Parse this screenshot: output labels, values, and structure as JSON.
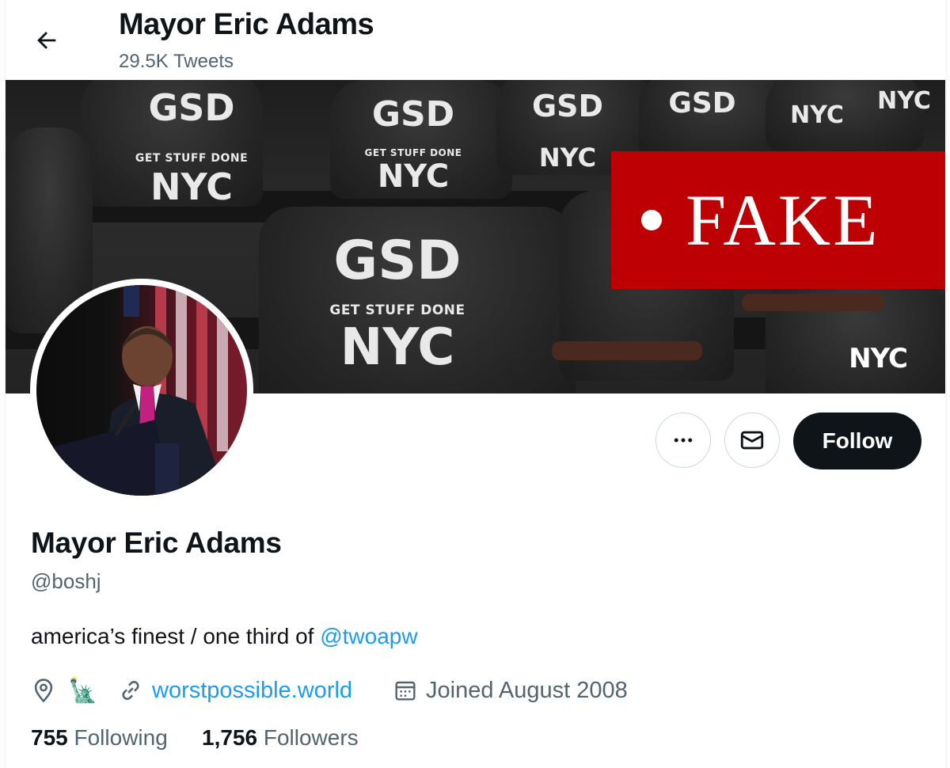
{
  "header": {
    "title": "Mayor Eric Adams",
    "tweet_count": "29.5K Tweets",
    "back_icon": "arrow-left-icon"
  },
  "banner": {
    "shirt_big": "GSD",
    "shirt_small": "GET STUFF DONE",
    "shirt_city": "NYC",
    "logo_text": "NYC",
    "overlay_label": "FAKE",
    "overlay_color": "#bd0003"
  },
  "actions": {
    "more_icon": "more-horizontal-icon",
    "message_icon": "envelope-icon",
    "follow_label": "Follow"
  },
  "profile": {
    "name": "Mayor Eric Adams",
    "handle": "@boshj",
    "bio_text": "america’s finest / one third of ",
    "bio_mention": "@twoapw",
    "location_icon": "map-pin-icon",
    "location_emoji": "🗽",
    "website_icon": "link-icon",
    "website": "worstpossible.world",
    "joined_icon": "calendar-icon",
    "joined": "Joined August 2008",
    "following_count": "755",
    "following_label": "Following",
    "followers_count": "1,756",
    "followers_label": "Followers"
  },
  "colors": {
    "accent": "#1d9bf0",
    "text_primary": "#0f1419",
    "text_secondary": "#536471",
    "button_dark": "#0f1419"
  }
}
